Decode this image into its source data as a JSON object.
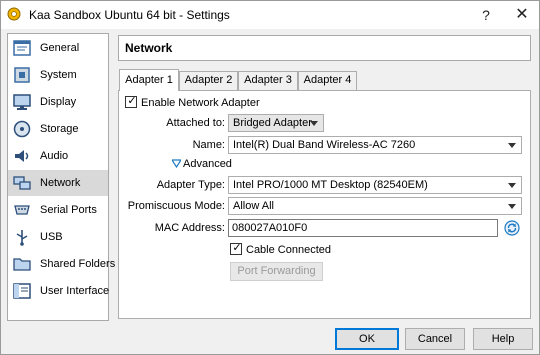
{
  "window": {
    "title": "Kaa Sandbox Ubuntu 64 bit - Settings",
    "help_glyph": "?",
    "close_glyph": "✕"
  },
  "sidebar": {
    "items": [
      {
        "label": "General",
        "icon": "general-icon",
        "selected": false
      },
      {
        "label": "System",
        "icon": "system-icon",
        "selected": false
      },
      {
        "label": "Display",
        "icon": "display-icon",
        "selected": false
      },
      {
        "label": "Storage",
        "icon": "storage-icon",
        "selected": false
      },
      {
        "label": "Audio",
        "icon": "audio-icon",
        "selected": false
      },
      {
        "label": "Network",
        "icon": "network-icon",
        "selected": true
      },
      {
        "label": "Serial Ports",
        "icon": "serial-ports-icon",
        "selected": false
      },
      {
        "label": "USB",
        "icon": "usb-icon",
        "selected": false
      },
      {
        "label": "Shared Folders",
        "icon": "shared-folders-icon",
        "selected": false
      },
      {
        "label": "User Interface",
        "icon": "user-interface-icon",
        "selected": false
      }
    ]
  },
  "header": {
    "title": "Network"
  },
  "tabs": [
    {
      "label": "Adapter 1",
      "active": true
    },
    {
      "label": "Adapter 2",
      "active": false
    },
    {
      "label": "Adapter 3",
      "active": false
    },
    {
      "label": "Adapter 4",
      "active": false
    }
  ],
  "adapter": {
    "enable_label": "Enable Network Adapter",
    "enable_checked": true,
    "attached_label": "Attached to:",
    "attached_value": "Bridged Adapter",
    "name_label": "Name:",
    "name_value": "Intel(R) Dual Band Wireless-AC 7260",
    "advanced_label": "Advanced",
    "adapter_type_label": "Adapter Type:",
    "adapter_type_value": "Intel PRO/1000 MT Desktop (82540EM)",
    "promiscuous_label": "Promiscuous Mode:",
    "promiscuous_value": "Allow All",
    "mac_label": "MAC Address:",
    "mac_value": "080027A010F0",
    "cable_label": "Cable Connected",
    "cable_checked": true,
    "port_forwarding_label": "Port Forwarding"
  },
  "footer": {
    "ok_label": "OK",
    "cancel_label": "Cancel",
    "help_label": "Help"
  },
  "colors": {
    "selection_bg": "#d9d9d9",
    "accent": "#0078d7",
    "header_bg": "#ffffff"
  }
}
